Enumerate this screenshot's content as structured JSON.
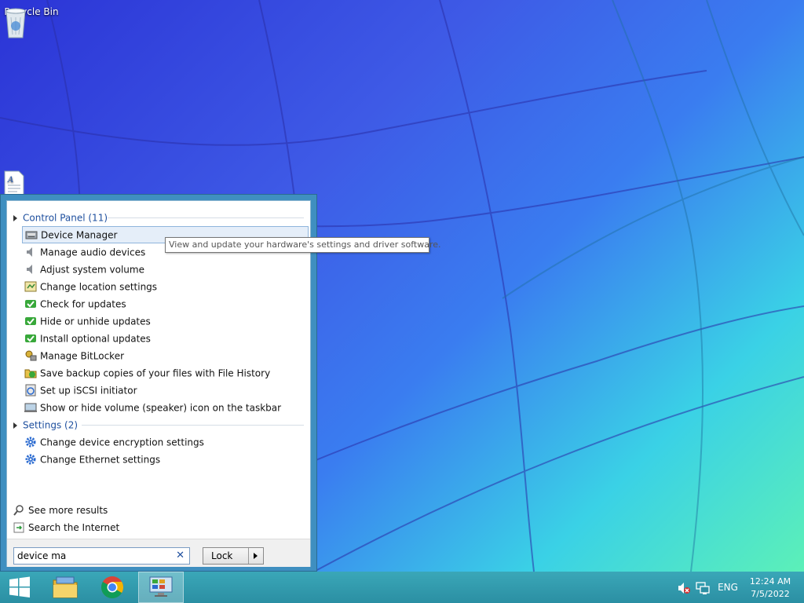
{
  "desktop": {
    "icons": [
      {
        "label": "Recycle Bin",
        "icon": "recycle-bin-icon"
      },
      {
        "label": "",
        "icon": "document-icon"
      }
    ]
  },
  "start_menu": {
    "groups": [
      {
        "title": "Control Panel (11)",
        "items": [
          {
            "label": "Device Manager",
            "icon": "device-manager-icon",
            "selected": true
          },
          {
            "label": "Manage audio devices",
            "icon": "speaker-icon"
          },
          {
            "label": "Adjust system volume",
            "icon": "speaker-icon"
          },
          {
            "label": "Change location settings",
            "icon": "location-icon"
          },
          {
            "label": "Check for updates",
            "icon": "windows-update-icon"
          },
          {
            "label": "Hide or unhide updates",
            "icon": "windows-update-icon"
          },
          {
            "label": "Install optional updates",
            "icon": "windows-update-icon"
          },
          {
            "label": "Manage BitLocker",
            "icon": "bitlocker-icon"
          },
          {
            "label": "Save backup copies of your files with File History",
            "icon": "file-history-icon"
          },
          {
            "label": "Set up iSCSI initiator",
            "icon": "iscsi-icon"
          },
          {
            "label": "Show or hide volume (speaker) icon on the taskbar",
            "icon": "taskbar-icon"
          }
        ]
      },
      {
        "title": "Settings (2)",
        "items": [
          {
            "label": "Change device encryption settings",
            "icon": "gear-icon"
          },
          {
            "label": "Change Ethernet settings",
            "icon": "gear-icon"
          }
        ]
      }
    ],
    "see_more": "See more results",
    "search_internet": "Search the Internet",
    "search": {
      "value": "device ma",
      "placeholder": ""
    },
    "lock_label": "Lock",
    "tooltip": "View and update your hardware's settings and driver software."
  },
  "taskbar": {
    "apps": [
      "start-icon",
      "file-explorer-icon",
      "chrome-icon",
      "control-panel-icon"
    ],
    "language": "ENG",
    "time": "12:24 AM",
    "date": "7/5/2022"
  },
  "colors": {
    "accent": "#3f8fc0",
    "link": "#1e4f9e",
    "taskbar": "#2b8fa3"
  }
}
